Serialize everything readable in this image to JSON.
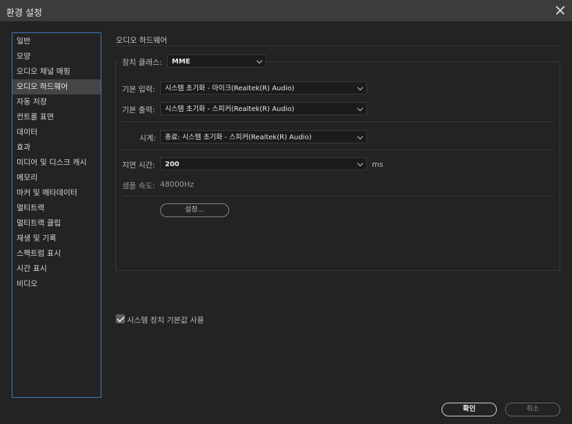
{
  "window": {
    "title": "환경 설정"
  },
  "sidebar": {
    "items": [
      {
        "label": "일반"
      },
      {
        "label": "모양"
      },
      {
        "label": "오디오 채널 매핑"
      },
      {
        "label": "오디오 하드웨어"
      },
      {
        "label": "자동 저장"
      },
      {
        "label": "컨트롤 표면"
      },
      {
        "label": "데이터"
      },
      {
        "label": "효과"
      },
      {
        "label": "미디어 및 디스크 캐시"
      },
      {
        "label": "메모리"
      },
      {
        "label": "마커 및 메타데이터"
      },
      {
        "label": "멀티트랙"
      },
      {
        "label": "멀티트랙 클립"
      },
      {
        "label": "재생 및 기록"
      },
      {
        "label": "스펙트럼 표시"
      },
      {
        "label": "시간 표시"
      },
      {
        "label": "비디오"
      }
    ],
    "active_index": 3
  },
  "panel": {
    "title": "오디오 하드웨어",
    "device_class": {
      "label": "장치 클래스:",
      "value": "MME"
    },
    "default_input": {
      "label": "기본 입력:",
      "value": "시스템 초기화 - 마이크(Realtek(R) Audio)"
    },
    "default_output": {
      "label": "기본 출력:",
      "value": "시스템 초기화 - 스피커(Realtek(R) Audio)"
    },
    "clock": {
      "label": "시계:",
      "value": "종료: 시스템 초기화 - 스피커(Realtek(R) Audio)"
    },
    "latency": {
      "label": "지연 시간:",
      "value": "200",
      "unit": "ms"
    },
    "sample_rate": {
      "label": "샘플 속도:",
      "value": "48000Hz"
    },
    "settings_button": "설정..."
  },
  "use_system_defaults": {
    "label": "시스템 장치 기본값 사용",
    "checked": true
  },
  "footer": {
    "ok": "확인",
    "cancel": "취소"
  }
}
